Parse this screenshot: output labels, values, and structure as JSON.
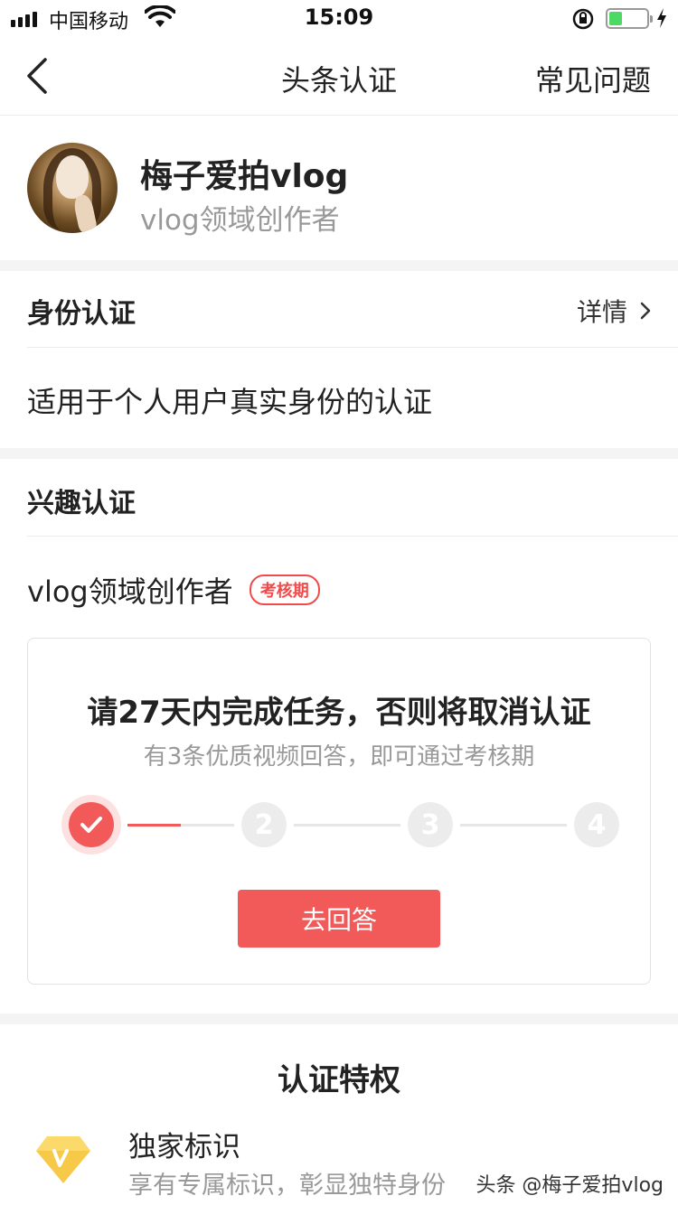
{
  "status_bar": {
    "carrier": "中国移动",
    "time": "15:09",
    "battery_level": 0.35,
    "colors": {
      "battery": "#4cd964"
    }
  },
  "nav": {
    "title": "头条认证",
    "faq_label": "常见问题",
    "back_icon": "chevron-left-icon"
  },
  "profile": {
    "name": "梅子爱拍vlog",
    "subtitle": "vlog领域创作者"
  },
  "identity": {
    "title": "身份认证",
    "detail_label": "详情",
    "description": "适用于个人用户真实身份的认证"
  },
  "interest": {
    "title": "兴趣认证",
    "label": "vlog领域创作者",
    "badge": "考核期"
  },
  "task": {
    "title": "请27天内完成任务，否则将取消认证",
    "subtitle": "有3条优质视频回答，即可通过考核期",
    "steps": [
      "2",
      "3",
      "4"
    ],
    "completed_steps": 1,
    "first_segment_progress": 0.5,
    "button_label": "去回答",
    "colors": {
      "accent": "#f25a5a"
    }
  },
  "privileges": {
    "title": "认证特权",
    "items": [
      {
        "name": "独家标识",
        "description": "享有专属标识，彰显独特身份",
        "icon": "diamond-v-icon"
      }
    ]
  },
  "watermark": "头条 @梅子爱拍vlog"
}
